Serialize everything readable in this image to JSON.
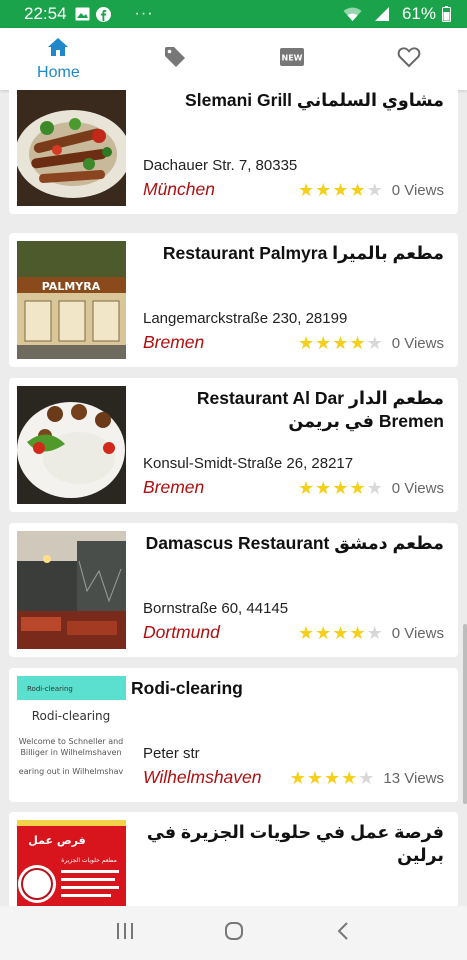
{
  "status_bar": {
    "time": "22:54",
    "dots": "···",
    "battery": "61%",
    "icons": [
      "image-icon",
      "facebook-icon",
      "wifi-icon",
      "signal-icon",
      "battery-icon"
    ]
  },
  "tabs": [
    {
      "label": "Home",
      "icon": "home-icon",
      "active": true
    },
    {
      "label": "",
      "icon": "tag-icon",
      "active": false
    },
    {
      "label": "",
      "icon": "new-icon",
      "active": false,
      "badge_text": "NEW"
    },
    {
      "label": "",
      "icon": "heart-icon",
      "active": false
    }
  ],
  "restaurants": [
    {
      "title": "مشاوي السلماني Slemani Grill",
      "address": "Dachauer Str. 7, 80335",
      "city": "München",
      "rating": 4,
      "views": "0 Views"
    },
    {
      "title": "مطعم بالميرا Restaurant Palmyra",
      "address": "Langemarckstraße 230, 28199",
      "city": "Bremen",
      "rating": 4,
      "views": "0 Views",
      "thumb_sign": "PALMYRA"
    },
    {
      "title": "مطعم الدار Restaurant Al Dar Bremen في بريمن",
      "address": "Konsul-Smidt-Straße 26, 28217",
      "city": "Bremen",
      "rating": 4,
      "views": "0 Views"
    },
    {
      "title": "مطعم دمشق Damascus Restaurant",
      "address": "Bornstraße 60, 44145",
      "city": "Dortmund",
      "rating": 4,
      "views": "0 Views"
    },
    {
      "title": "Rodi-clearing",
      "address": "Peter str",
      "city": "Wilhelmshaven",
      "rating": 4,
      "views": "13 Views",
      "thumb_lines": [
        "Rodi-clearing",
        "Rodi-clearing",
        "Welcome to Schneller and",
        "Billiger in Wilhelmshaven",
        "earing out in Wilhelmshav"
      ]
    },
    {
      "title": "فرصة عمل في حلويات الجزيرة في برلين",
      "address": "",
      "city": "",
      "rating": 0,
      "views": "",
      "thumb_lines": [
        "فرص عمل",
        "مطعم حلويات الجزيرة"
      ]
    }
  ],
  "nav_buttons": [
    "recents-icon",
    "home-circle-icon",
    "back-icon"
  ],
  "colors": {
    "status_bar": "#1aa34a",
    "accent": "#1e88c8",
    "city": "#b00f0f",
    "star": "#f6cf1b"
  }
}
